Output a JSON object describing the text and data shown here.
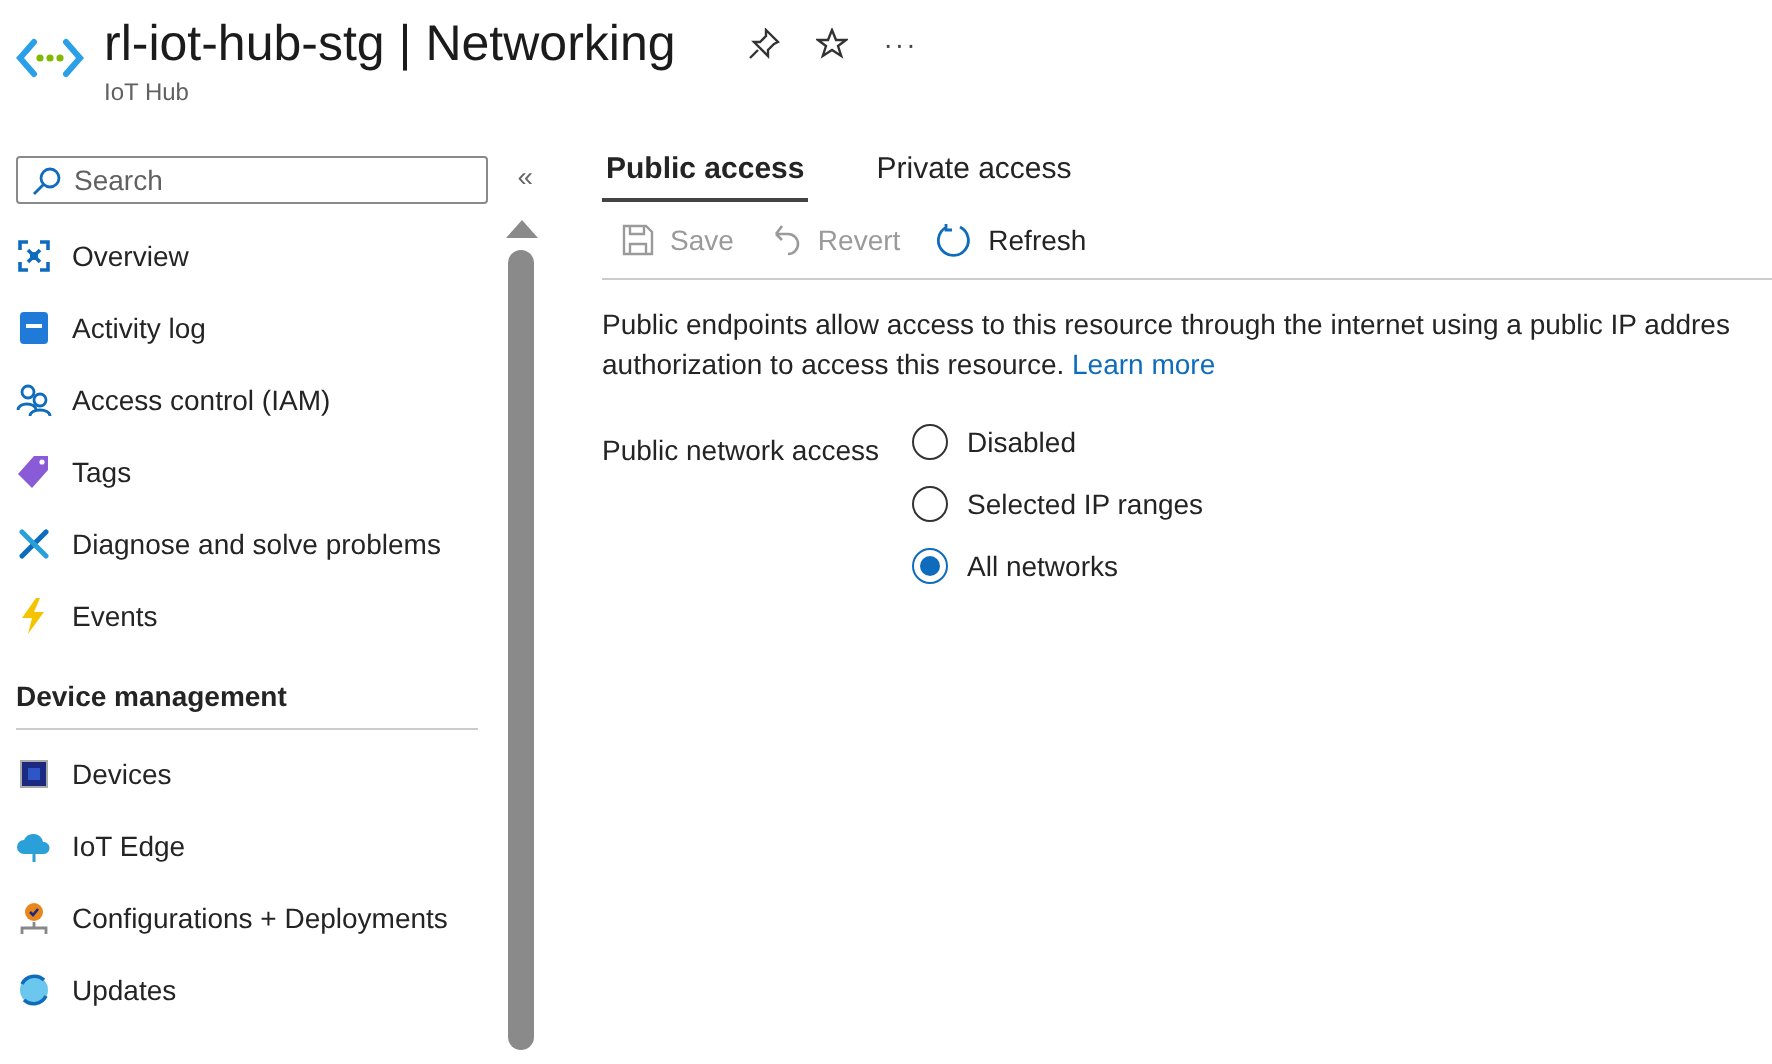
{
  "header": {
    "title": "rl-iot-hub-stg | Networking",
    "subtitle": "IoT Hub",
    "more": "···"
  },
  "sidebar": {
    "search": {
      "placeholder": "Search"
    },
    "collapse": "«",
    "items": [
      {
        "label": "Overview",
        "selected": false
      },
      {
        "label": "Activity log",
        "selected": false
      },
      {
        "label": "Access control (IAM)",
        "selected": false
      },
      {
        "label": "Tags",
        "selected": false
      },
      {
        "label": "Diagnose and solve problems",
        "selected": false
      },
      {
        "label": "Events",
        "selected": false
      }
    ],
    "sections": [
      {
        "heading": "Device management",
        "items": [
          {
            "label": "Devices",
            "selected": false
          },
          {
            "label": "IoT Edge",
            "selected": false
          },
          {
            "label": "Configurations + Deployments",
            "selected": false
          },
          {
            "label": "Updates",
            "selected": false
          }
        ]
      }
    ]
  },
  "tabs": [
    {
      "label": "Public access",
      "selected": true
    },
    {
      "label": "Private access",
      "selected": false
    }
  ],
  "toolbar": [
    {
      "label": "Save",
      "kind": "save",
      "disabled": true
    },
    {
      "label": "Revert",
      "kind": "revert",
      "disabled": true
    },
    {
      "label": "Refresh",
      "kind": "refresh",
      "disabled": false
    }
  ],
  "description": {
    "lines": [
      "Public endpoints allow access to this resource through the internet using a public IP addres",
      "authorization to access this resource."
    ],
    "link": "Learn more"
  },
  "public_network_access": {
    "label": "Public network access",
    "options": [
      {
        "label": "Disabled",
        "selected": false
      },
      {
        "label": "Selected IP ranges",
        "selected": false
      },
      {
        "label": "All networks",
        "selected": true
      }
    ]
  }
}
